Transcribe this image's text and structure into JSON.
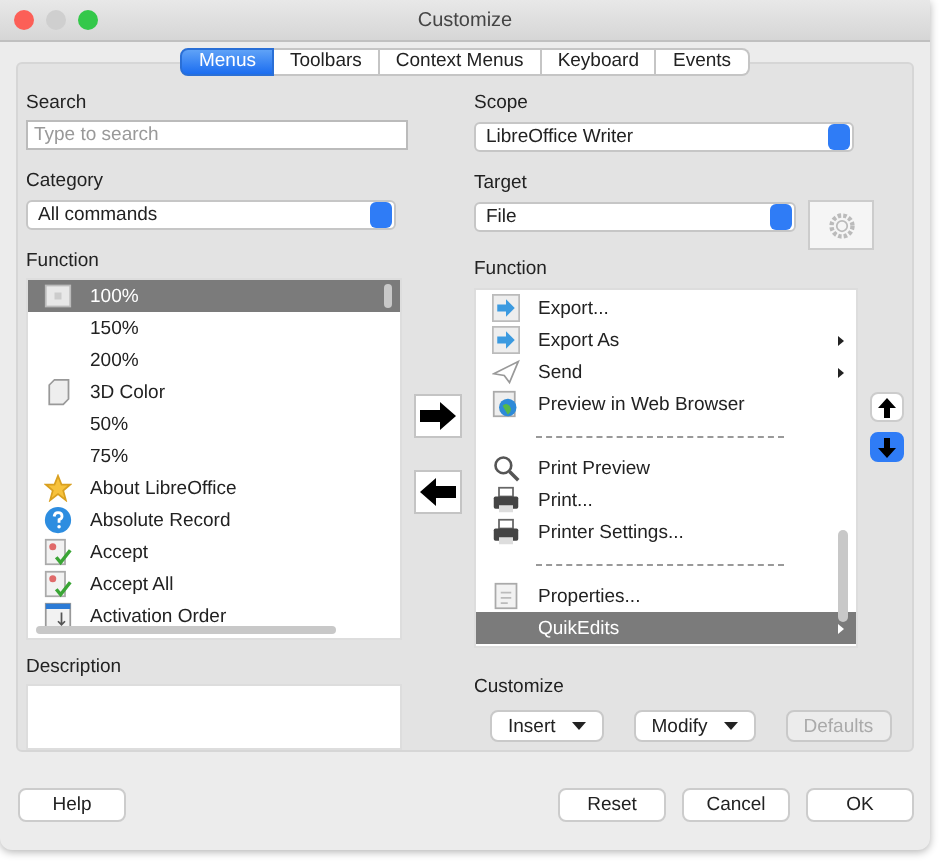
{
  "window": {
    "title": "Customize"
  },
  "tabs": [
    {
      "label": "Menus",
      "selected": true
    },
    {
      "label": "Toolbars",
      "selected": false
    },
    {
      "label": "Context Menus",
      "selected": false
    },
    {
      "label": "Keyboard",
      "selected": false
    },
    {
      "label": "Events",
      "selected": false
    }
  ],
  "search": {
    "label": "Search",
    "placeholder": "Type to search"
  },
  "category": {
    "label": "Category",
    "value": "All commands"
  },
  "scope": {
    "label": "Scope",
    "value": "LibreOffice Writer"
  },
  "target": {
    "label": "Target",
    "value": "File"
  },
  "function_left": {
    "label": "Function",
    "items": [
      {
        "text": "100%",
        "selected": true
      },
      {
        "text": "150%",
        "selected": false
      },
      {
        "text": "200%",
        "selected": false
      },
      {
        "text": "3D Color",
        "selected": false
      },
      {
        "text": "50%",
        "selected": false
      },
      {
        "text": "75%",
        "selected": false
      },
      {
        "text": "About LibreOffice",
        "selected": false
      },
      {
        "text": "Absolute Record",
        "selected": false
      },
      {
        "text": "Accept",
        "selected": false
      },
      {
        "text": "Accept All",
        "selected": false
      },
      {
        "text": "Activation Order",
        "selected": false
      }
    ]
  },
  "function_right": {
    "label": "Function",
    "items": [
      {
        "kind": "item",
        "text": "Export...",
        "submenu": false,
        "selected": false
      },
      {
        "kind": "item",
        "text": "Export As",
        "submenu": true,
        "selected": false
      },
      {
        "kind": "item",
        "text": "Send",
        "submenu": true,
        "selected": false
      },
      {
        "kind": "item",
        "text": "Preview in Web Browser",
        "submenu": false,
        "selected": false
      },
      {
        "kind": "separator"
      },
      {
        "kind": "item",
        "text": "Print Preview",
        "submenu": false,
        "selected": false
      },
      {
        "kind": "item",
        "text": "Print...",
        "submenu": false,
        "selected": false
      },
      {
        "kind": "item",
        "text": "Printer Settings...",
        "submenu": false,
        "selected": false
      },
      {
        "kind": "separator"
      },
      {
        "kind": "item",
        "text": "Properties...",
        "submenu": false,
        "selected": false
      },
      {
        "kind": "item",
        "text": "QuikEdits",
        "submenu": true,
        "selected": true
      }
    ]
  },
  "description": {
    "label": "Description"
  },
  "customize": {
    "label": "Customize",
    "buttons": [
      {
        "label": "Insert",
        "dropdown": true,
        "disabled": false
      },
      {
        "label": "Modify",
        "dropdown": true,
        "disabled": false
      },
      {
        "label": "Defaults",
        "dropdown": false,
        "disabled": true
      }
    ]
  },
  "footer": {
    "left": [
      "Help"
    ],
    "right": [
      "Reset",
      "Cancel",
      "OK"
    ]
  }
}
